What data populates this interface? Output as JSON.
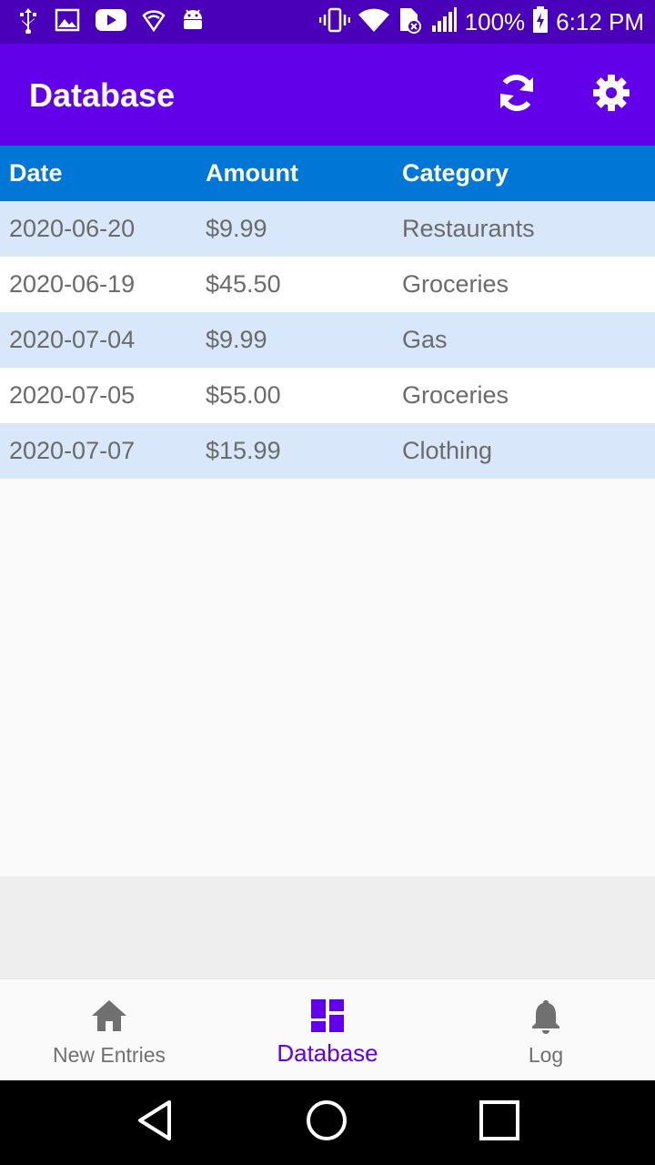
{
  "status_bar": {
    "battery": "100%",
    "time": "6:12 PM",
    "icons": [
      "usb-icon",
      "image-icon",
      "youtube-icon",
      "vpn-icon",
      "android-icon",
      "vibrate-icon",
      "wifi-icon",
      "sim-icon",
      "signal-icon",
      "battery-icon"
    ]
  },
  "app_bar": {
    "title": "Database",
    "actions": [
      "refresh-icon",
      "settings-icon"
    ],
    "color": "#6200ea"
  },
  "table": {
    "headers": [
      "Date",
      "Amount",
      "Category"
    ],
    "header_color": "#0077d6",
    "stripe_color": "#d8e8fa",
    "rows": [
      {
        "date": "2020-06-20",
        "amount": "$9.99",
        "category": "Restaurants"
      },
      {
        "date": "2020-06-19",
        "amount": "$45.50",
        "category": "Groceries"
      },
      {
        "date": "2020-07-04",
        "amount": "$9.99",
        "category": "Gas"
      },
      {
        "date": "2020-07-05",
        "amount": "$55.00",
        "category": "Groceries"
      },
      {
        "date": "2020-07-07",
        "amount": "$15.99",
        "category": "Clothing"
      }
    ]
  },
  "bottom_nav": {
    "items": [
      {
        "label": "New Entries",
        "icon": "home-icon",
        "active": false
      },
      {
        "label": "Database",
        "icon": "dashboard-icon",
        "active": true
      },
      {
        "label": "Log",
        "icon": "bell-icon",
        "active": false
      }
    ],
    "active_color": "#6200ea"
  },
  "system_nav": [
    "back-icon",
    "home-circle-icon",
    "recents-icon"
  ]
}
